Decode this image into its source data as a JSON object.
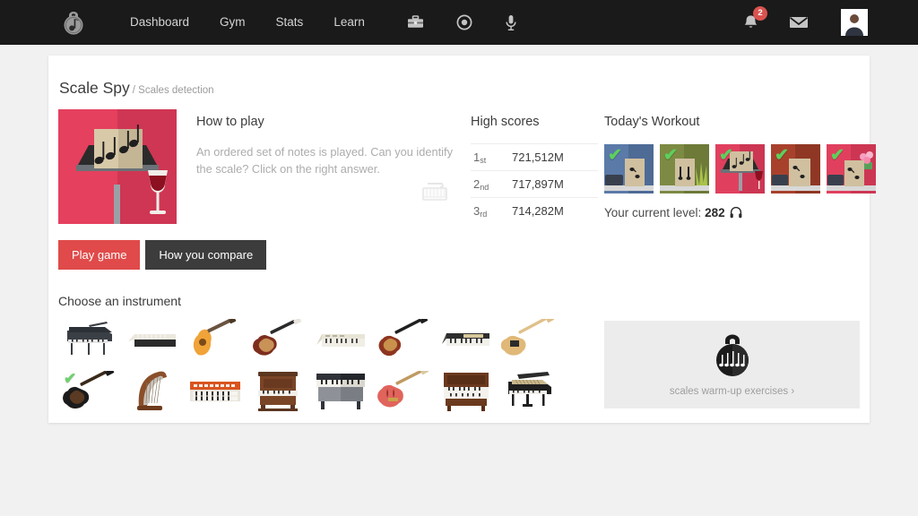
{
  "navbar": {
    "logo_icon": "kettlebell-music-note-logo",
    "links": [
      {
        "label": "Dashboard",
        "name": "nav-link-dashboard"
      },
      {
        "label": "Gym",
        "name": "nav-link-gym"
      },
      {
        "label": "Stats",
        "name": "nav-link-stats"
      },
      {
        "label": "Learn",
        "name": "nav-link-learn"
      }
    ],
    "icons": [
      {
        "name": "briefcase-icon"
      },
      {
        "name": "record-circle-icon"
      },
      {
        "name": "microphone-icon"
      }
    ],
    "notifications": {
      "icon": "bell-icon",
      "count": "2"
    },
    "mail": {
      "icon": "envelope-icon"
    },
    "avatar": {
      "icon": "user-avatar"
    },
    "background_color": "#1a1a1a"
  },
  "page": {
    "title": "Scale Spy",
    "subtitle": "/ Scales detection",
    "background_color": "#f1f1f1",
    "card_color": "#ffffff"
  },
  "hero": {
    "name": "scale-spy-thumbnail",
    "alt": "music stand with notes and wine glass"
  },
  "howto": {
    "title": "How to play",
    "body": "An ordered set of notes is played. Can you identify the scale? Click on the right answer.",
    "icon": "keyboard-icon"
  },
  "highscores": {
    "title": "High scores",
    "rows": [
      {
        "rank": "1",
        "suffix": "st",
        "value": "721,512M"
      },
      {
        "rank": "2",
        "suffix": "nd",
        "value": "717,897M"
      },
      {
        "rank": "3",
        "suffix": "rd",
        "value": "714,282M"
      }
    ]
  },
  "workout": {
    "title": "Today's Workout",
    "thumbs": [
      {
        "name": "workout-thumb-1",
        "bg": "#5b7aa8",
        "panel": "#4e6b96",
        "check": "✔"
      },
      {
        "name": "workout-thumb-2",
        "bg": "#7d8a43",
        "panel": "#6d7a38",
        "check": "✔"
      },
      {
        "name": "workout-thumb-3",
        "bg": "#e0405e",
        "panel": "#cc3653",
        "check": "✔"
      },
      {
        "name": "workout-thumb-4",
        "bg": "#a8412c",
        "panel": "#8f3724",
        "check": "✔"
      },
      {
        "name": "workout-thumb-5",
        "bg": "#e0405e",
        "panel": "#cc3653",
        "check": "✔"
      }
    ],
    "level_label": "Your current level:",
    "level_value": "282",
    "level_icon": "headphones-icon"
  },
  "buttons": {
    "play": {
      "label": "Play game",
      "color": "#e04a4a"
    },
    "compare": {
      "label": "How you compare",
      "color": "#3c3c3c"
    }
  },
  "instruments": {
    "title": "Choose an instrument",
    "items": [
      {
        "name": "instrument-grand-piano-black",
        "label": "grand piano",
        "selected": false
      },
      {
        "name": "instrument-keyboard-slim",
        "label": "slim keyboard",
        "selected": false
      },
      {
        "name": "instrument-acoustic-guitar",
        "label": "acoustic guitar",
        "selected": false
      },
      {
        "name": "instrument-electric-guitar-sunburst",
        "label": "electric guitar",
        "selected": false
      },
      {
        "name": "instrument-synthesizer-cream",
        "label": "synthesizer",
        "selected": false
      },
      {
        "name": "instrument-bass-guitar",
        "label": "bass guitar",
        "selected": false
      },
      {
        "name": "instrument-organ-keyboard",
        "label": "organ keyboard",
        "selected": false
      },
      {
        "name": "instrument-telecaster-guitar",
        "label": "telecaster guitar",
        "selected": false
      },
      {
        "name": "instrument-les-paul-black",
        "label": "black les paul guitar",
        "selected": true
      },
      {
        "name": "instrument-harp",
        "label": "harp",
        "selected": false
      },
      {
        "name": "instrument-analog-synth-orange",
        "label": "analog synth",
        "selected": false
      },
      {
        "name": "instrument-upright-piano-wood",
        "label": "upright piano",
        "selected": false
      },
      {
        "name": "instrument-electric-piano-grey",
        "label": "electric piano",
        "selected": false
      },
      {
        "name": "instrument-hollow-body-guitar-red",
        "label": "hollow body guitar",
        "selected": false
      },
      {
        "name": "instrument-pipe-organ-wood",
        "label": "pipe organ",
        "selected": false
      },
      {
        "name": "instrument-grand-piano-open",
        "label": "open grand piano",
        "selected": false
      }
    ]
  },
  "warmup": {
    "label": "scales warm-up exercises ›",
    "icon": "kettlebell-notes-icon",
    "background_color": "#ececec"
  }
}
